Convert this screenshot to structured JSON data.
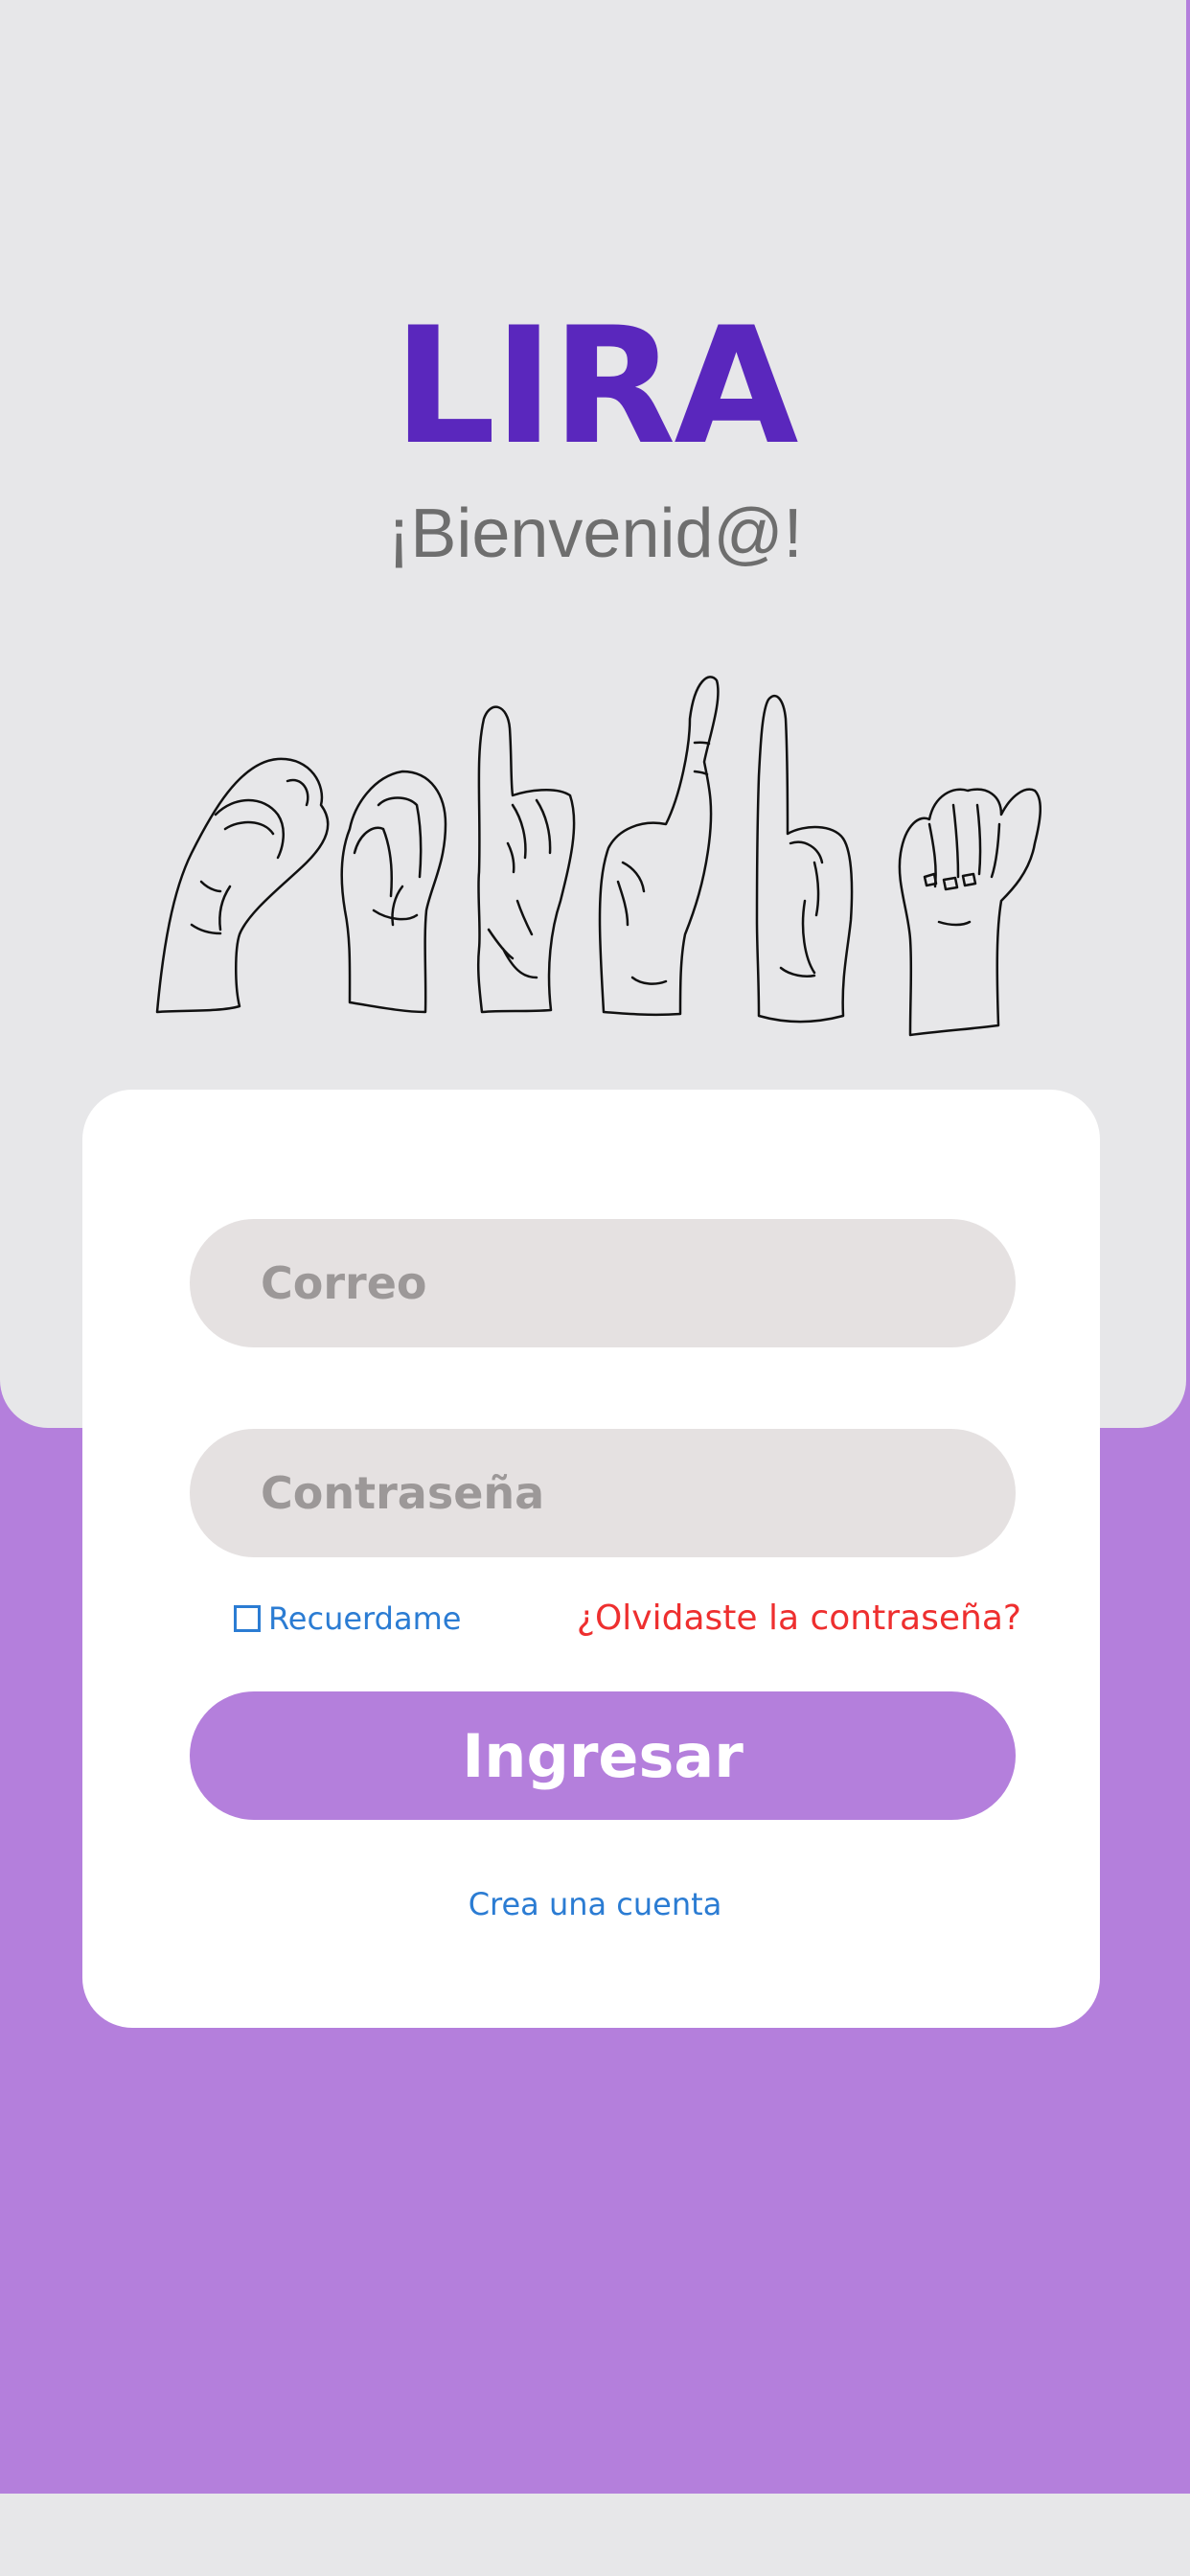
{
  "app": {
    "name": "LIRA",
    "welcome": "¡Bienvenid@!"
  },
  "form": {
    "email_placeholder": "Correo",
    "password_placeholder": "Contraseña",
    "remember_label": "Recuerdame",
    "remember_checked": false,
    "forgot_label": "¿Olvidaste la contraseña?",
    "submit_label": "Ingresar",
    "create_account_label": "Crea una cuenta"
  },
  "illustration": {
    "name": "sign-language-hands-icon"
  },
  "colors": {
    "brand_purple": "#5a27bd",
    "accent_lilac": "#b47fdc",
    "panel_gray": "#e7e7e9",
    "input_gray": "#e5e1e1",
    "link_blue": "#2b7cd3",
    "warning_red": "#ee2f2f"
  }
}
